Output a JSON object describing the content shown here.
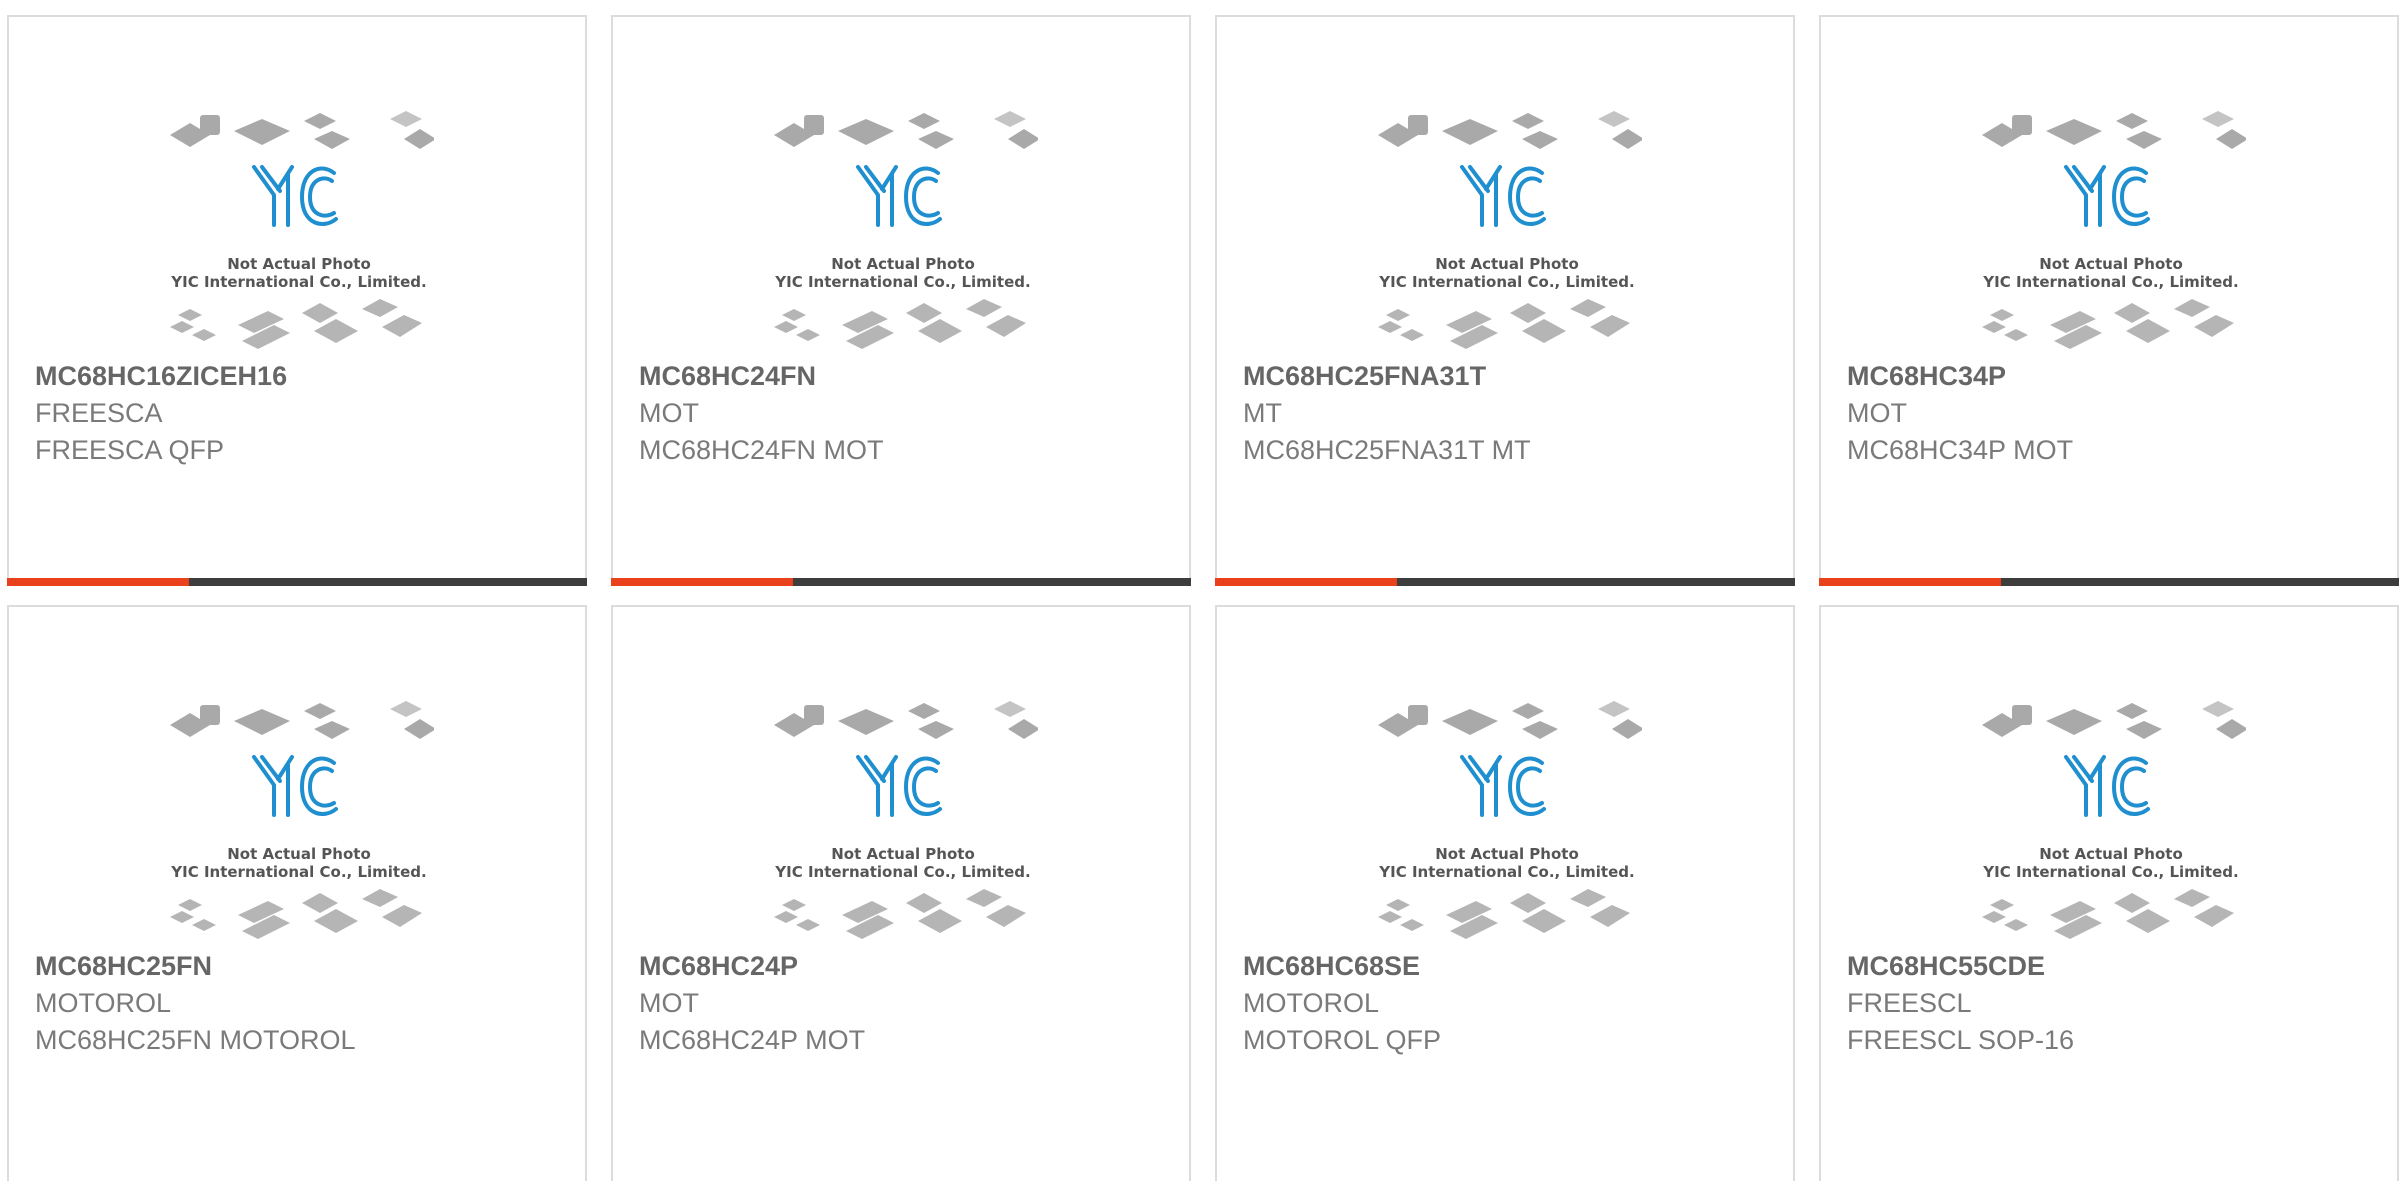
{
  "placeholder": {
    "line1": "Not Actual Photo",
    "line2": "YIC International Co., Limited.",
    "logo": "YIC"
  },
  "colors": {
    "accent": "#e8411b",
    "bar": "#3d3d3d",
    "logo_blue": "#1f8fd0",
    "text": "#7a7a7a"
  },
  "products": [
    {
      "part": "MC68HC16ZICEH16",
      "maker": "FREESCA",
      "desc": "FREESCA QFP"
    },
    {
      "part": "MC68HC24FN",
      "maker": "MOT",
      "desc": "MC68HC24FN MOT"
    },
    {
      "part": "MC68HC25FNA31T",
      "maker": "MT",
      "desc": "MC68HC25FNA31T MT"
    },
    {
      "part": "MC68HC34P",
      "maker": "MOT",
      "desc": "MC68HC34P MOT"
    },
    {
      "part": "MC68HC25FN",
      "maker": "MOTOROL",
      "desc": "MC68HC25FN MOTOROL"
    },
    {
      "part": "MC68HC24P",
      "maker": "MOT",
      "desc": "MC68HC24P MOT"
    },
    {
      "part": "MC68HC68SE",
      "maker": "MOTOROL",
      "desc": "MOTOROL QFP"
    },
    {
      "part": "MC68HC55CDE",
      "maker": "FREESCL",
      "desc": "FREESCL SOP-16"
    }
  ]
}
